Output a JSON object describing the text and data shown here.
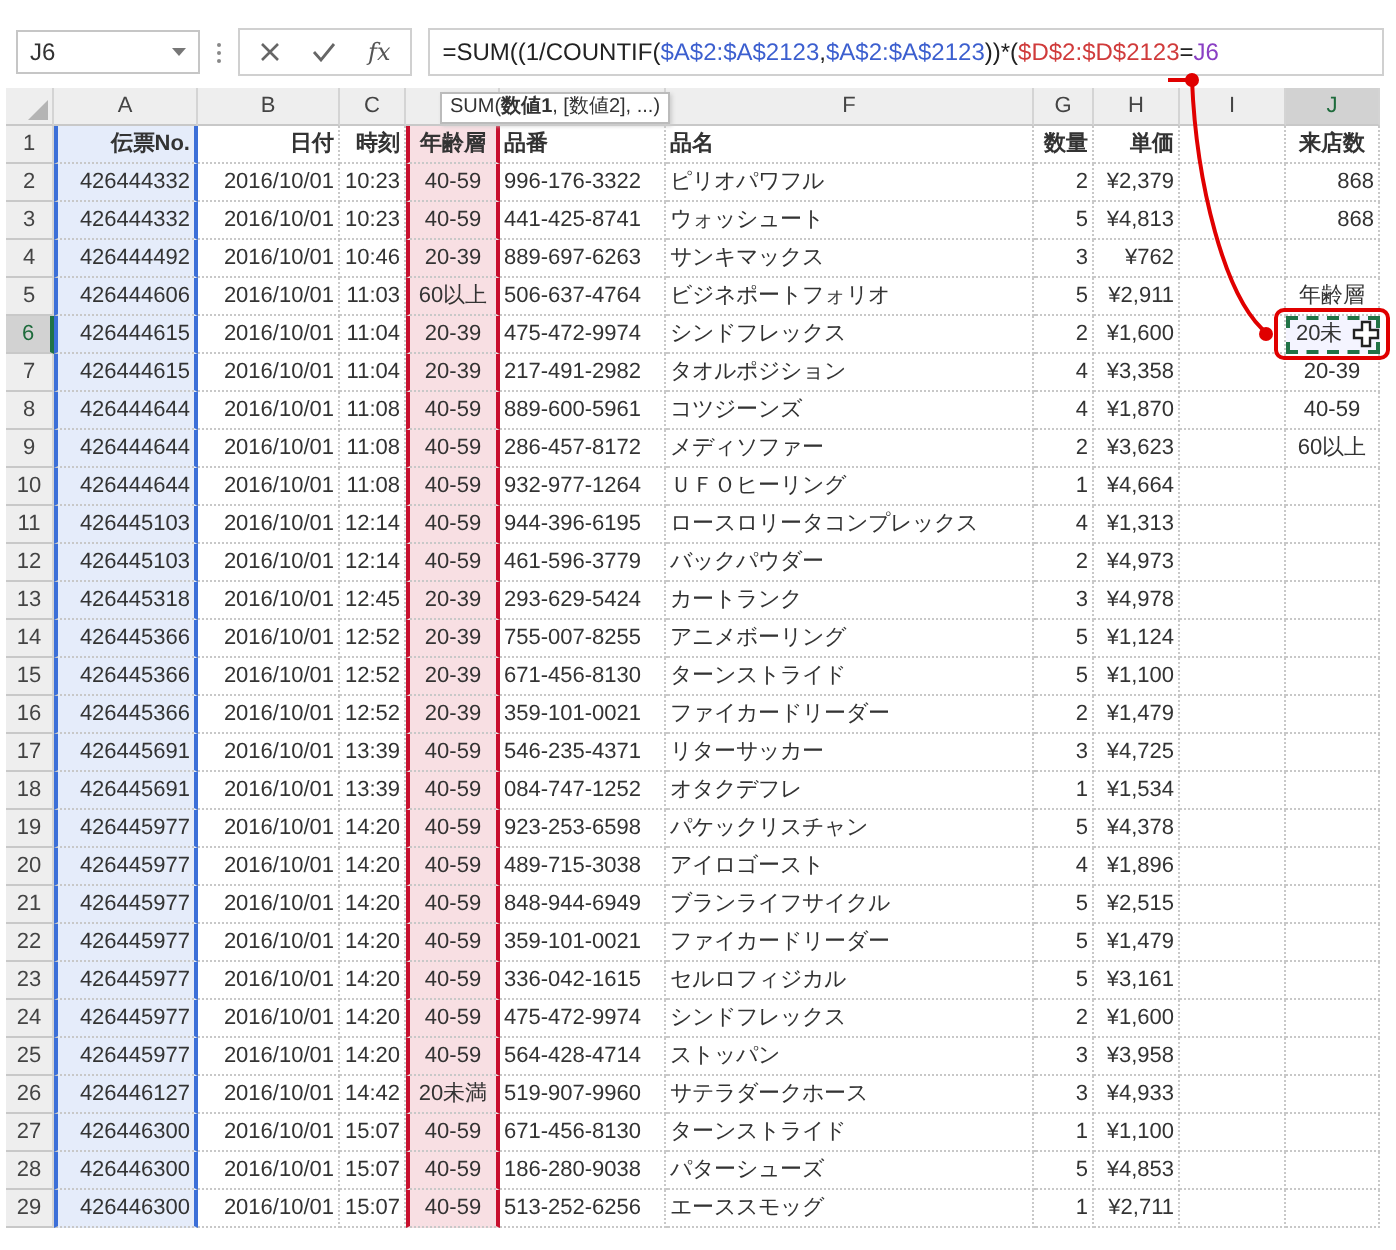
{
  "formula_bar": {
    "name_box": "J6",
    "function_button": "fx",
    "formula": [
      {
        "text": "=SUM((1/COUNTIF(",
        "color": "#222222"
      },
      {
        "text": "$A$2:$A$2123",
        "color": "#3c5fcf"
      },
      {
        "text": ",",
        "color": "#222222"
      },
      {
        "text": "$A$2:$A$2123",
        "color": "#3c5fcf"
      },
      {
        "text": "))*(",
        "color": "#222222"
      },
      {
        "text": "$D$2:$D$2123",
        "color": "#d03b3b"
      },
      {
        "text": "=",
        "color": "#222222"
      },
      {
        "text": "J6",
        "color": "#8a3fc4"
      }
    ]
  },
  "tooltip": "SUM(**数値1**, [数値2], ...)",
  "sheet": {
    "columns": [
      {
        "letter": "A",
        "color": "#3c6fd8",
        "selected": false
      },
      {
        "letter": "B",
        "selected": false
      },
      {
        "letter": "C",
        "selected": false
      },
      {
        "color": "#c8102e",
        "selected": false
      },
      {
        "selected": false
      },
      {
        "letter": "F",
        "selected": false
      },
      {
        "letter": "G",
        "selected": false
      },
      {
        "letter": "H",
        "selected": false
      },
      {
        "letter": "I",
        "selected": false
      },
      {
        "letter": "J",
        "selected": true
      }
    ],
    "rows": [
      {
        "number": "1",
        "kind": "header",
        "selected": false,
        "cells": [
          "伝票No.",
          "日付",
          "時刻",
          "年齢層",
          "品番",
          "品名",
          "数量",
          "単価"
        ],
        "column_j": {
          "text": "来店数",
          "kind": "heading"
        }
      },
      {
        "number": "2",
        "kind": "data",
        "selected": false,
        "cells": [
          "426444332",
          "2016/10/01",
          "10:23",
          "40-59",
          "996-176-3322",
          "ピリオパワフル",
          "2",
          "¥2,379"
        ],
        "column_j": {
          "text": "868",
          "kind": "number"
        }
      },
      {
        "number": "3",
        "kind": "data",
        "selected": false,
        "cells": [
          "426444332",
          "2016/10/01",
          "10:23",
          "40-59",
          "441-425-8741",
          "ウォッシュート",
          "5",
          "¥4,813"
        ],
        "column_j": {
          "text": "868",
          "kind": "number"
        }
      },
      {
        "number": "4",
        "kind": "data",
        "selected": false,
        "cells": [
          "426444492",
          "2016/10/01",
          "10:46",
          "20-39",
          "889-697-6263",
          "サンキマックス",
          "3",
          "¥762"
        ]
      },
      {
        "number": "5",
        "kind": "data",
        "selected": false,
        "cells": [
          "426444606",
          "2016/10/01",
          "11:03",
          "60以上",
          "506-637-4764",
          "ビジネポートフォリオ",
          "5",
          "¥2,911"
        ],
        "column_j": {
          "text": "年齢層",
          "kind": "heading"
        }
      },
      {
        "number": "6",
        "kind": "data",
        "selected": true,
        "cells": [
          "426444615",
          "2016/10/01",
          "11:04",
          "20-39",
          "475-472-9974",
          "シンドフレックス",
          "2",
          "¥1,600"
        ],
        "column_j": {
          "text": "20未",
          "kind": "label"
        }
      },
      {
        "number": "7",
        "kind": "data",
        "selected": false,
        "cells": [
          "426444615",
          "2016/10/01",
          "11:04",
          "20-39",
          "217-491-2982",
          "タオルポジション",
          "4",
          "¥3,358"
        ],
        "column_j": {
          "text": "20-39",
          "kind": "label"
        }
      },
      {
        "number": "8",
        "kind": "data",
        "selected": false,
        "cells": [
          "426444644",
          "2016/10/01",
          "11:08",
          "40-59",
          "889-600-5961",
          "コツジーンズ",
          "4",
          "¥1,870"
        ],
        "column_j": {
          "text": "40-59",
          "kind": "label"
        }
      },
      {
        "number": "9",
        "kind": "data",
        "selected": false,
        "cells": [
          "426444644",
          "2016/10/01",
          "11:08",
          "40-59",
          "286-457-8172",
          "メディソファー",
          "2",
          "¥3,623"
        ],
        "column_j": {
          "text": "60以上",
          "kind": "label"
        }
      },
      {
        "number": "10",
        "kind": "data",
        "selected": false,
        "cells": [
          "426444644",
          "2016/10/01",
          "11:08",
          "40-59",
          "932-977-1264",
          "ＵＦＯヒーリング",
          "1",
          "¥4,664"
        ]
      },
      {
        "number": "11",
        "kind": "data",
        "selected": false,
        "cells": [
          "426445103",
          "2016/10/01",
          "12:14",
          "40-59",
          "944-396-6195",
          "ロースロリータコンプレックス",
          "4",
          "¥1,313"
        ]
      },
      {
        "number": "12",
        "kind": "data",
        "selected": false,
        "cells": [
          "426445103",
          "2016/10/01",
          "12:14",
          "40-59",
          "461-596-3779",
          "バックパウダー",
          "2",
          "¥4,973"
        ]
      },
      {
        "number": "13",
        "kind": "data",
        "selected": false,
        "cells": [
          "426445318",
          "2016/10/01",
          "12:45",
          "20-39",
          "293-629-5424",
          "カートランク",
          "3",
          "¥4,978"
        ]
      },
      {
        "number": "14",
        "kind": "data",
        "selected": false,
        "cells": [
          "426445366",
          "2016/10/01",
          "12:52",
          "20-39",
          "755-007-8255",
          "アニメボーリング",
          "5",
          "¥1,124"
        ]
      },
      {
        "number": "15",
        "kind": "data",
        "selected": false,
        "cells": [
          "426445366",
          "2016/10/01",
          "12:52",
          "20-39",
          "671-456-8130",
          "ターンストライド",
          "5",
          "¥1,100"
        ]
      },
      {
        "number": "16",
        "kind": "data",
        "selected": false,
        "cells": [
          "426445366",
          "2016/10/01",
          "12:52",
          "20-39",
          "359-101-0021",
          "ファイカードリーダー",
          "2",
          "¥1,479"
        ]
      },
      {
        "number": "17",
        "kind": "data",
        "selected": false,
        "cells": [
          "426445691",
          "2016/10/01",
          "13:39",
          "40-59",
          "546-235-4371",
          "リターサッカー",
          "3",
          "¥4,725"
        ]
      },
      {
        "number": "18",
        "kind": "data",
        "selected": false,
        "cells": [
          "426445691",
          "2016/10/01",
          "13:39",
          "40-59",
          "084-747-1252",
          "オタクデフレ",
          "1",
          "¥1,534"
        ]
      },
      {
        "number": "19",
        "kind": "data",
        "selected": false,
        "cells": [
          "426445977",
          "2016/10/01",
          "14:20",
          "40-59",
          "923-253-6598",
          "パケックリスチャン",
          "5",
          "¥4,378"
        ]
      },
      {
        "number": "20",
        "kind": "data",
        "selected": false,
        "cells": [
          "426445977",
          "2016/10/01",
          "14:20",
          "40-59",
          "489-715-3038",
          "アイロゴースト",
          "4",
          "¥1,896"
        ]
      },
      {
        "number": "21",
        "kind": "data",
        "selected": false,
        "cells": [
          "426445977",
          "2016/10/01",
          "14:20",
          "40-59",
          "848-944-6949",
          "ブランライフサイクル",
          "5",
          "¥2,515"
        ]
      },
      {
        "number": "22",
        "kind": "data",
        "selected": false,
        "cells": [
          "426445977",
          "2016/10/01",
          "14:20",
          "40-59",
          "359-101-0021",
          "ファイカードリーダー",
          "5",
          "¥1,479"
        ]
      },
      {
        "number": "23",
        "kind": "data",
        "selected": false,
        "cells": [
          "426445977",
          "2016/10/01",
          "14:20",
          "40-59",
          "336-042-1615",
          "セルロフィジカル",
          "5",
          "¥3,161"
        ]
      },
      {
        "number": "24",
        "kind": "data",
        "selected": false,
        "cells": [
          "426445977",
          "2016/10/01",
          "14:20",
          "40-59",
          "475-472-9974",
          "シンドフレックス",
          "2",
          "¥1,600"
        ]
      },
      {
        "number": "25",
        "kind": "data",
        "selected": false,
        "cells": [
          "426445977",
          "2016/10/01",
          "14:20",
          "40-59",
          "564-428-4714",
          "ストッパン",
          "3",
          "¥3,958"
        ]
      },
      {
        "number": "26",
        "kind": "data",
        "selected": false,
        "cells": [
          "426446127",
          "2016/10/01",
          "14:42",
          "20未満",
          "519-907-9960",
          "サテラダークホース",
          "3",
          "¥4,933"
        ]
      },
      {
        "number": "27",
        "kind": "data",
        "selected": false,
        "cells": [
          "426446300",
          "2016/10/01",
          "15:07",
          "40-59",
          "671-456-8130",
          "ターンストライド",
          "1",
          "¥1,100"
        ]
      },
      {
        "number": "28",
        "kind": "data",
        "selected": false,
        "cells": [
          "426446300",
          "2016/10/01",
          "15:07",
          "40-59",
          "186-280-9038",
          "パターシューズ",
          "5",
          "¥4,853"
        ]
      },
      {
        "number": "29",
        "kind": "data",
        "selected": false,
        "cells": [
          "426446300",
          "2016/10/01",
          "15:07",
          "40-59",
          "513-252-6256",
          "エーススモッグ",
          "1",
          "¥2,711"
        ]
      }
    ]
  }
}
